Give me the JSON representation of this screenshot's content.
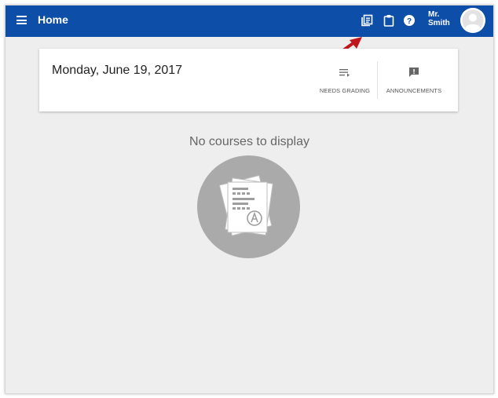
{
  "header": {
    "title": "Home",
    "user_first": "Mr.",
    "user_last": "Smith"
  },
  "card": {
    "date": "Monday, June 19, 2017",
    "needs_grading_label": "NEEDS GRADING",
    "announcements_label": "ANNOUNCEMENTS"
  },
  "main": {
    "empty_message": "No courses to display"
  },
  "icons": {
    "menu": "hamburger-menu-icon",
    "toolbar": [
      "class-list-icon",
      "clipboard-icon",
      "help-icon"
    ],
    "avatar": "user-avatar-icon",
    "needs_grading": "list-arrow-icon",
    "announcements": "announcement-icon",
    "illustration": "assignment-papers-icon"
  },
  "colors": {
    "topbar": "#0d4ea8",
    "background": "#eeeeee",
    "illustration_circle": "#aaaaaa",
    "annotation_arrow": "#c0161b"
  }
}
